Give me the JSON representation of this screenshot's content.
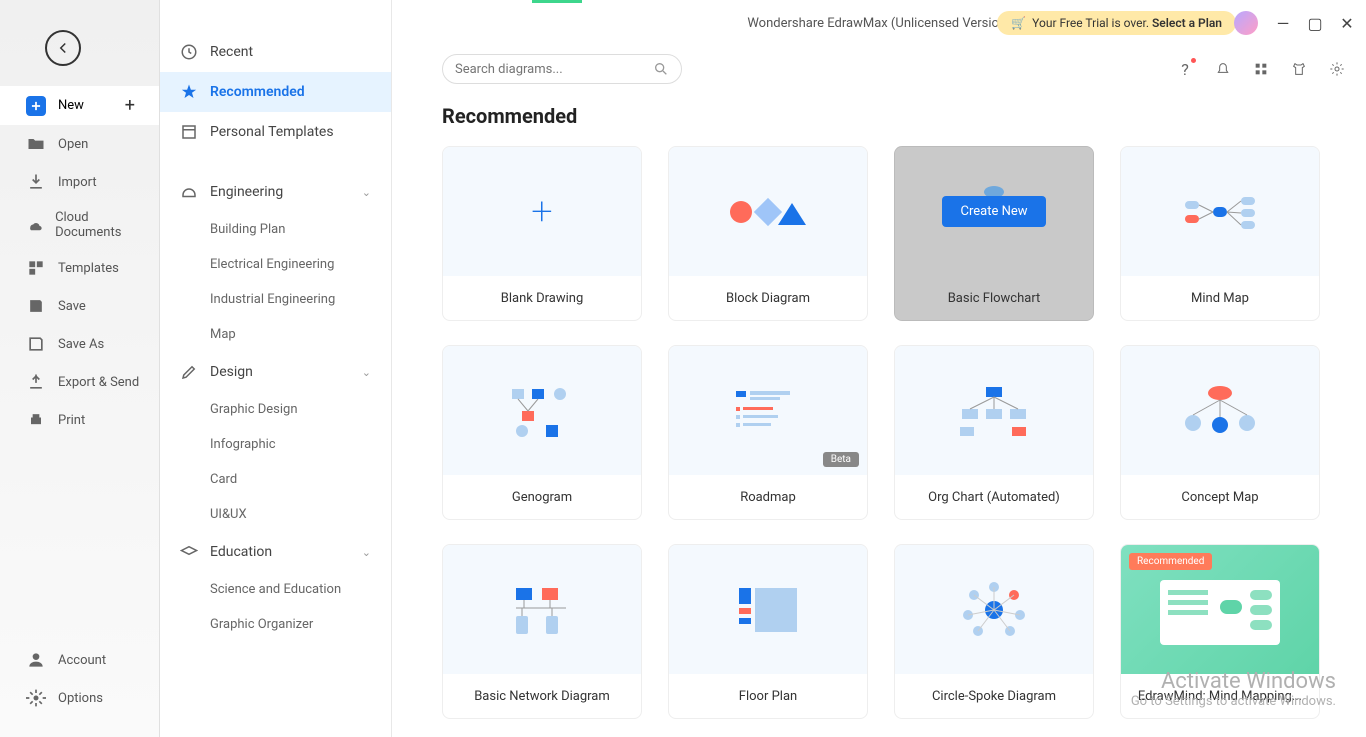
{
  "title": "Wondershare EdrawMax (Unlicensed Version)",
  "trial": {
    "prefix": "Your Free Trial is over. ",
    "action": "Select a Plan"
  },
  "search": {
    "placeholder": "Search diagrams..."
  },
  "primary_nav": {
    "new": "New",
    "open": "Open",
    "import": "Import",
    "cloud": "Cloud Documents",
    "templates": "Templates",
    "save": "Save",
    "saveas": "Save As",
    "export": "Export & Send",
    "print": "Print",
    "account": "Account",
    "options": "Options"
  },
  "categories": {
    "recent": "Recent",
    "recommended": "Recommended",
    "personal": "Personal Templates",
    "engineering": {
      "label": "Engineering",
      "items": [
        "Building Plan",
        "Electrical Engineering",
        "Industrial Engineering",
        "Map"
      ]
    },
    "design": {
      "label": "Design",
      "items": [
        "Graphic Design",
        "Infographic",
        "Card",
        "UI&UX"
      ]
    },
    "education": {
      "label": "Education",
      "items": [
        "Science and Education",
        "Graphic Organizer"
      ]
    }
  },
  "section_heading": "Recommended",
  "cards": [
    {
      "label": "Blank Drawing"
    },
    {
      "label": "Block Diagram"
    },
    {
      "label": "Basic Flowchart",
      "hovered": true,
      "cta": "Create New"
    },
    {
      "label": "Mind Map"
    },
    {
      "label": "Genogram"
    },
    {
      "label": "Roadmap",
      "beta": "Beta"
    },
    {
      "label": "Org Chart (Automated)"
    },
    {
      "label": "Concept Map"
    },
    {
      "label": "Basic Network Diagram"
    },
    {
      "label": "Floor Plan"
    },
    {
      "label": "Circle-Spoke Diagram"
    },
    {
      "label": "EdrawMind: Mind Mapping...",
      "recommended": "Recommended",
      "promo": true
    }
  ],
  "watermark": {
    "line1": "Activate Windows",
    "line2": "Go to Settings to activate Windows."
  }
}
